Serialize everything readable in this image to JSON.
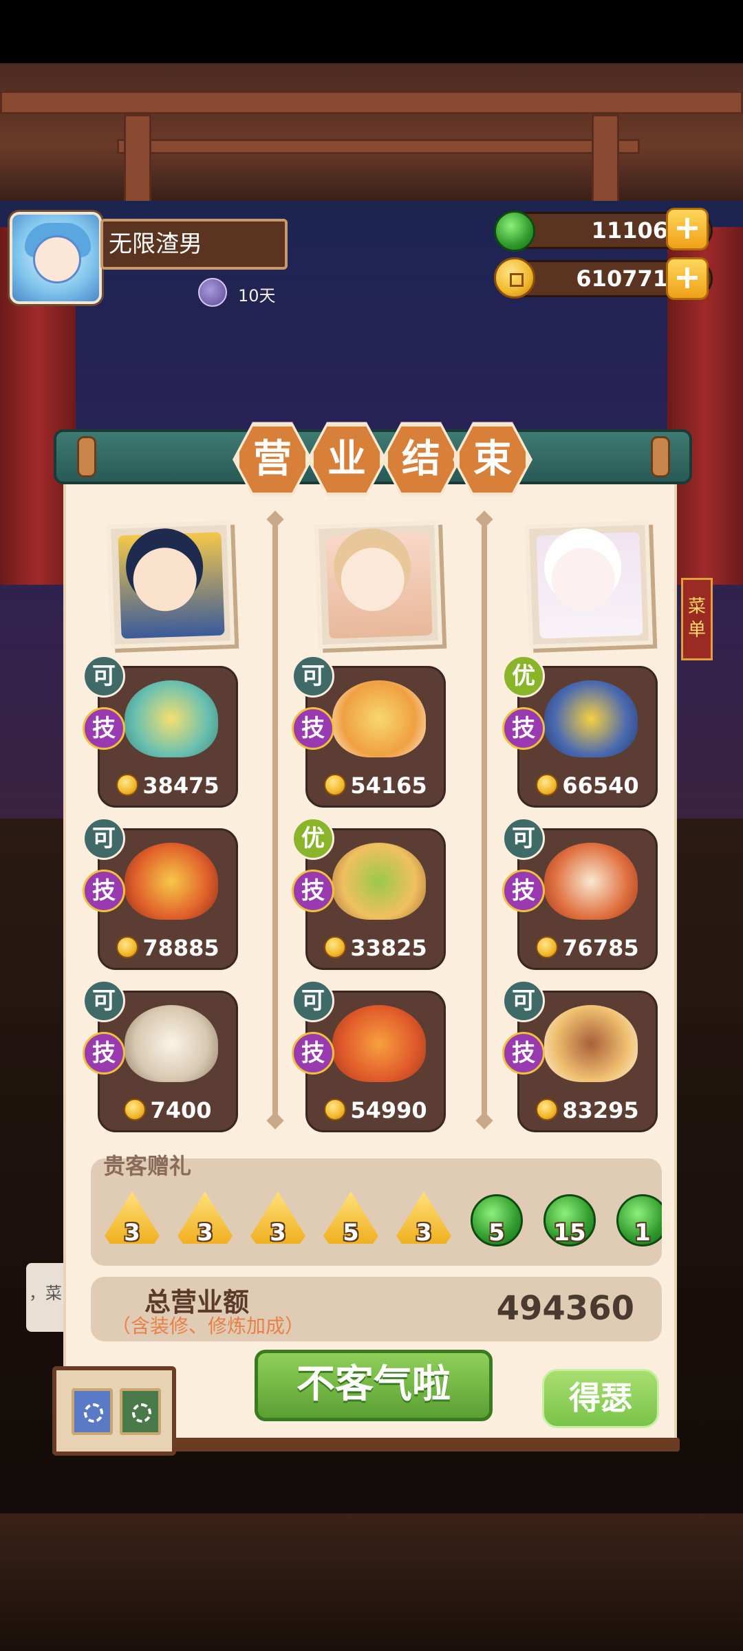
{
  "player": {
    "name": "无限渣男",
    "days": "10天"
  },
  "currency": {
    "jade": "11106",
    "coins": "610771"
  },
  "panel": {
    "title_chars": [
      "营",
      "业",
      "结",
      "束"
    ]
  },
  "dishes": [
    {
      "grade": "可",
      "skill": "技",
      "price": "38475"
    },
    {
      "grade": "可",
      "skill": "技",
      "price": "78885"
    },
    {
      "grade": "可",
      "skill": "技",
      "price": "7400"
    },
    {
      "grade": "可",
      "skill": "技",
      "price": "54165"
    },
    {
      "grade": "优",
      "skill": "技",
      "price": "33825"
    },
    {
      "grade": "可",
      "skill": "技",
      "price": "54990"
    },
    {
      "grade": "优",
      "skill": "技",
      "price": "66540"
    },
    {
      "grade": "可",
      "skill": "技",
      "price": "76785"
    },
    {
      "grade": "可",
      "skill": "技",
      "price": "83295"
    }
  ],
  "gifts": {
    "title": "贵客赠礼",
    "items": [
      {
        "type": "zongzi",
        "count": "3"
      },
      {
        "type": "zongzi",
        "count": "3"
      },
      {
        "type": "zongzi",
        "count": "3"
      },
      {
        "type": "zongzi",
        "count": "5"
      },
      {
        "type": "zongzi",
        "count": "3"
      },
      {
        "type": "jade",
        "count": "5"
      },
      {
        "type": "jade",
        "count": "15"
      },
      {
        "type": "jade",
        "count": "1"
      }
    ]
  },
  "total": {
    "label": "总营业额",
    "note": "（含装修、修炼加成）",
    "value": "494360"
  },
  "buttons": {
    "main": "不客气啦",
    "secondary": "得瑟"
  },
  "side": {
    "left_tab": "，菜",
    "menu_tab": "菜单"
  },
  "colors": {
    "panel_bg": "#fbeedd",
    "accent_green": "#5aa032",
    "title_orange": "#d8803a"
  }
}
